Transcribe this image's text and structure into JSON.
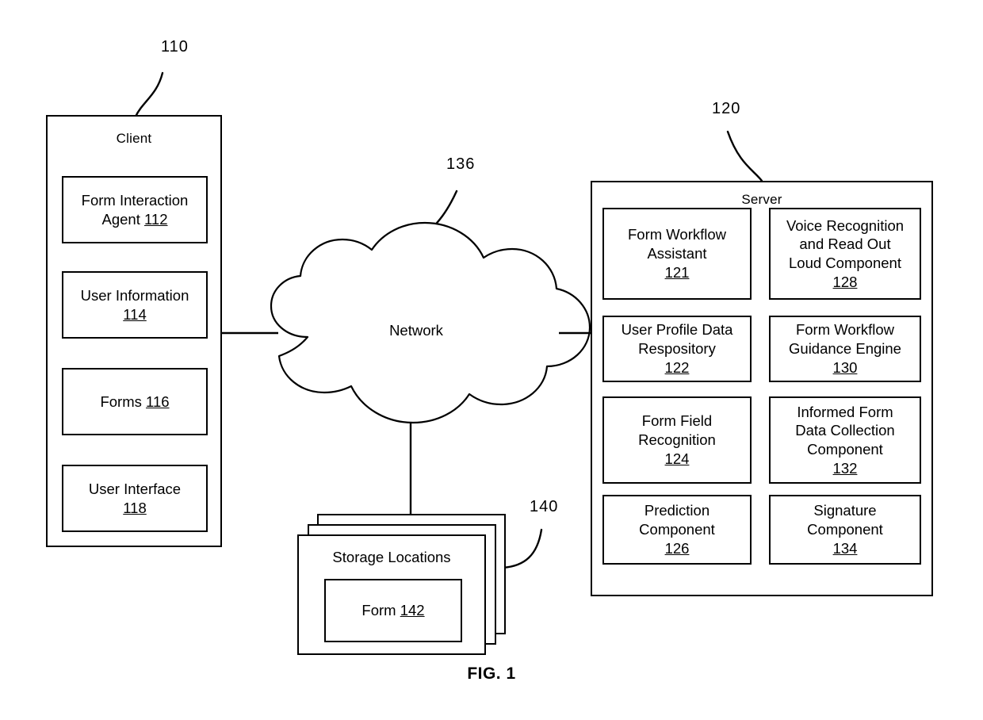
{
  "figure": {
    "caption": "FIG. 1"
  },
  "client": {
    "title": "Client",
    "callout": "110",
    "components": [
      {
        "name": "Form Interaction Agent",
        "text": "Form Interaction\nAgent ",
        "ref": "112"
      },
      {
        "name": "User Information",
        "text": "User Information\n",
        "ref": "114"
      },
      {
        "name": "Forms",
        "text": "Forms ",
        "ref": "116"
      },
      {
        "name": "User Interface",
        "text": "User Interface\n",
        "ref": "118"
      }
    ]
  },
  "network": {
    "label": "Network",
    "callout": "136"
  },
  "storage": {
    "title": "Storage Locations",
    "callout": "140",
    "form": {
      "text": "Form ",
      "ref": "142"
    }
  },
  "server": {
    "title": "Server",
    "callout": "120",
    "components": [
      {
        "name": "Form Workflow Assistant",
        "text": "Form Workflow\nAssistant\n",
        "ref": "121"
      },
      {
        "name": "Voice Recognition and Read Out Loud Component",
        "text": "Voice Recognition\nand Read Out\nLoud Component\n",
        "ref": "128"
      },
      {
        "name": "User Profile Data Respository",
        "text": "User Profile Data\nRespository\n",
        "ref": "122"
      },
      {
        "name": "Form Workflow Guidance Engine",
        "text": "Form Workflow\nGuidance Engine\n",
        "ref": "130"
      },
      {
        "name": "Form Field Recognition",
        "text": "Form Field\nRecognition\n",
        "ref": "124"
      },
      {
        "name": "Informed Form Data Collection Component",
        "text": "Informed Form\nData Collection\nComponent\n",
        "ref": "132"
      },
      {
        "name": "Prediction Component",
        "text": "Prediction\nComponent\n",
        "ref": "126"
      },
      {
        "name": "Signature Component",
        "text": "Signature\nComponent\n",
        "ref": "134"
      }
    ]
  }
}
